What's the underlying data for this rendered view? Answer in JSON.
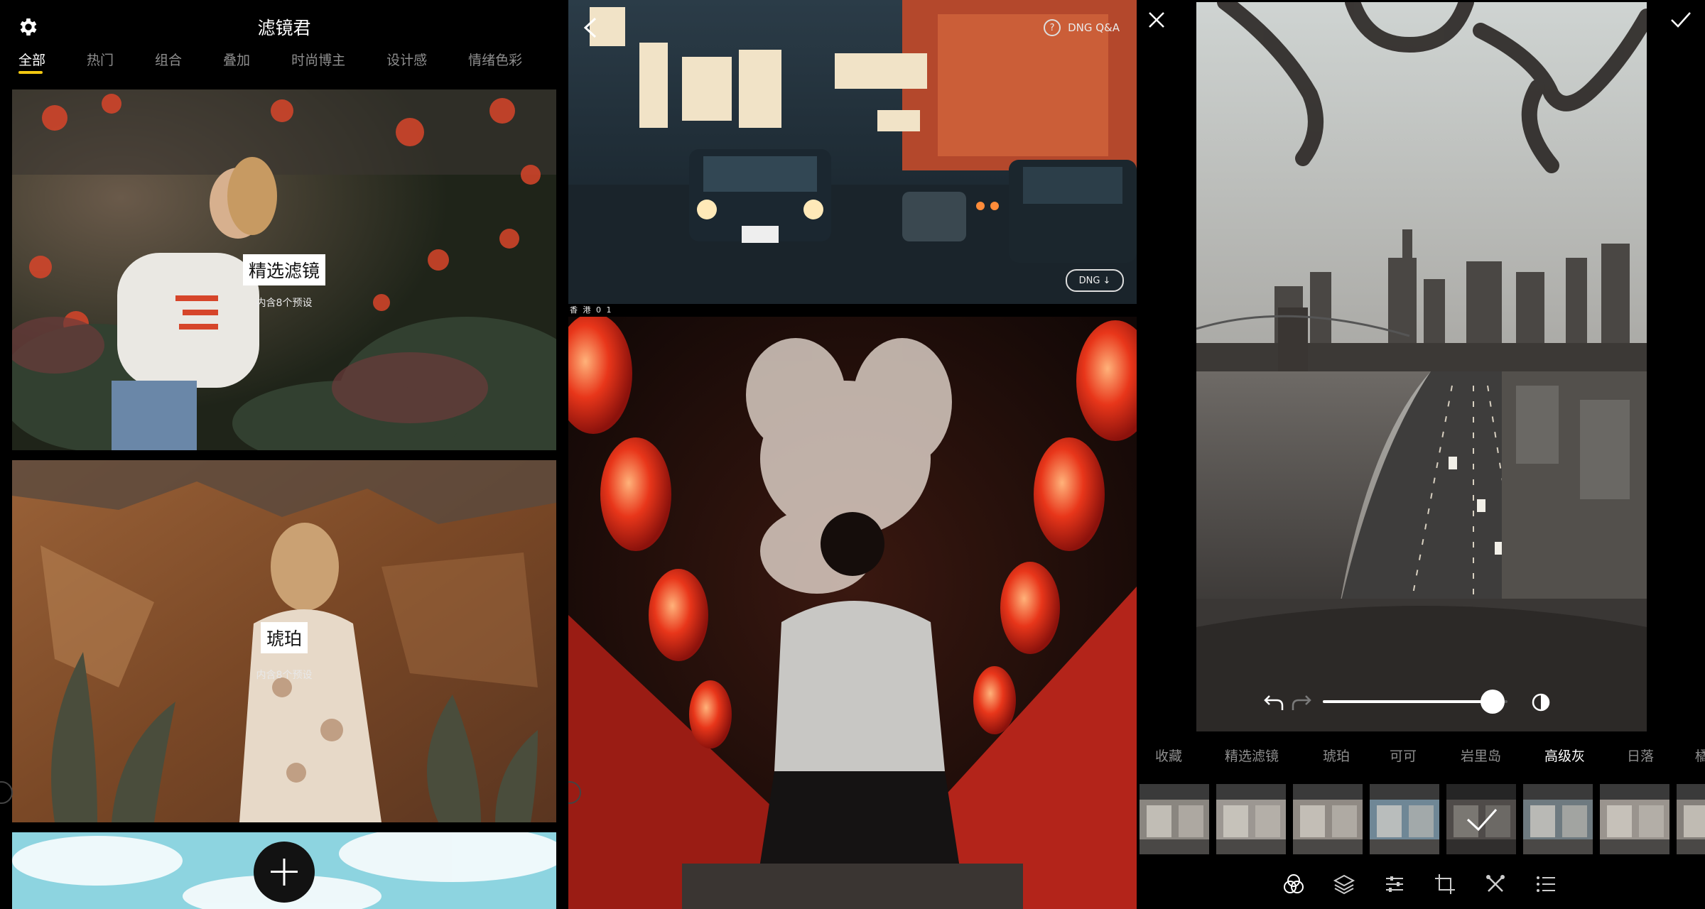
{
  "feed": {
    "title": "滤镜君",
    "tabs": [
      "全部",
      "热门",
      "组合",
      "叠加",
      "时尚博主",
      "设计感",
      "情绪色彩"
    ],
    "active_tab": "全部",
    "cards": [
      {
        "label": "精选滤镜",
        "subtitle": "内含8个预设"
      },
      {
        "label": "琥珀",
        "subtitle": "内含8个预设"
      }
    ]
  },
  "preview": {
    "help_label": "DNG Q&A",
    "dng_badge": "DNG ↓",
    "caption": "香 港 0 1"
  },
  "editor": {
    "categories": [
      "收藏",
      "精选滤镜",
      "琥珀",
      "可可",
      "岩里岛",
      "高级灰",
      "日落",
      "橘"
    ],
    "active_category": "高级灰",
    "intensity": 0.92,
    "selected_thumb": 4,
    "thumb_count": 8
  },
  "colors": {
    "accent": "#f2c811",
    "background": "#000000",
    "inactive_text": "#8e8e8e"
  }
}
